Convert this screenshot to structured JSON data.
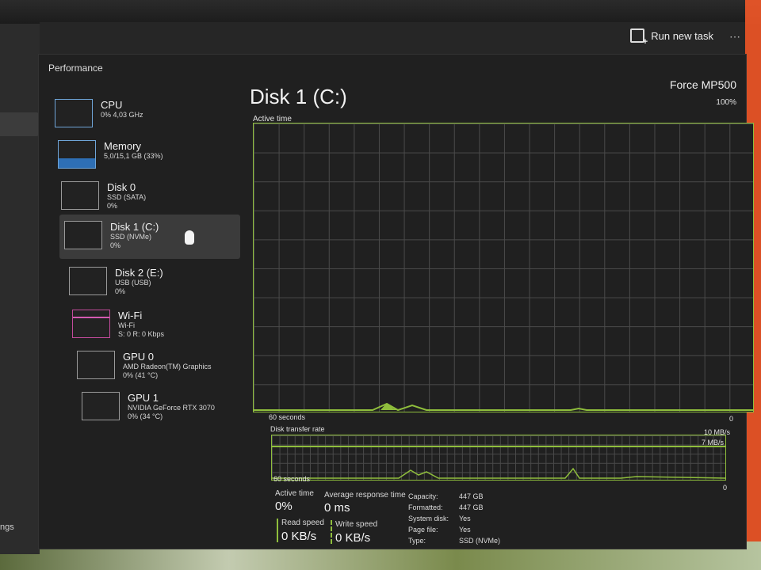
{
  "command_bar": {
    "run_new_task": "Run new task",
    "more": "⋯"
  },
  "window": {
    "title": "Performance"
  },
  "left_pane": {
    "partial_label": "ngs"
  },
  "devices": [
    {
      "name": "CPU",
      "line2": "0% 4,03 GHz",
      "line3": ""
    },
    {
      "name": "Memory",
      "line2": "5,0/15,1 GB (33%)",
      "line3": ""
    },
    {
      "name": "Disk 0",
      "line2": "SSD (SATA)",
      "line3": "0%"
    },
    {
      "name": "Disk 1 (C:)",
      "line2": "SSD (NVMe)",
      "line3": "0%"
    },
    {
      "name": "Disk 2 (E:)",
      "line2": "USB (USB)",
      "line3": "0%"
    },
    {
      "name": "Wi-Fi",
      "line2": "Wi-Fi",
      "line3": "S: 0 R: 0 Kbps"
    },
    {
      "name": "GPU 0",
      "line2": "AMD Radeon(TM) Graphics",
      "line3": "0% (41 °C)"
    },
    {
      "name": "GPU 1",
      "line2": "NVIDIA GeForce RTX 3070",
      "line3": "0% (34 °C)"
    }
  ],
  "main": {
    "title": "Disk 1 (C:)",
    "model": "Force MP500",
    "active_time_graph": {
      "label": "Active time",
      "max": "100%",
      "left_bottom": "60 seconds",
      "right_bottom": "0"
    },
    "transfer_graph": {
      "label": "Disk transfer rate",
      "max": "10 MB/s",
      "line_label": "7 MB/s",
      "left_bottom": "60 seconds",
      "right_bottom": "0"
    },
    "stats": {
      "active_time_label": "Active time",
      "active_time_value": "0%",
      "avg_response_label": "Average response time",
      "avg_response_value": "0 ms",
      "read_speed_label": "Read speed",
      "read_speed_value": "0 KB/s",
      "write_speed_label": "Write speed",
      "write_speed_value": "0 KB/s"
    },
    "properties": [
      {
        "k": "Capacity:",
        "v": "447 GB"
      },
      {
        "k": "Formatted:",
        "v": "447 GB"
      },
      {
        "k": "System disk:",
        "v": "Yes"
      },
      {
        "k": "Page file:",
        "v": "Yes"
      },
      {
        "k": "Type:",
        "v": "SSD (NVMe)"
      }
    ]
  },
  "colors": {
    "graph_green": "#8fbe3c",
    "cpu_blue": "#6fa5d8",
    "wifi_pink": "#c24b9b",
    "accent": "#ff5a28"
  }
}
